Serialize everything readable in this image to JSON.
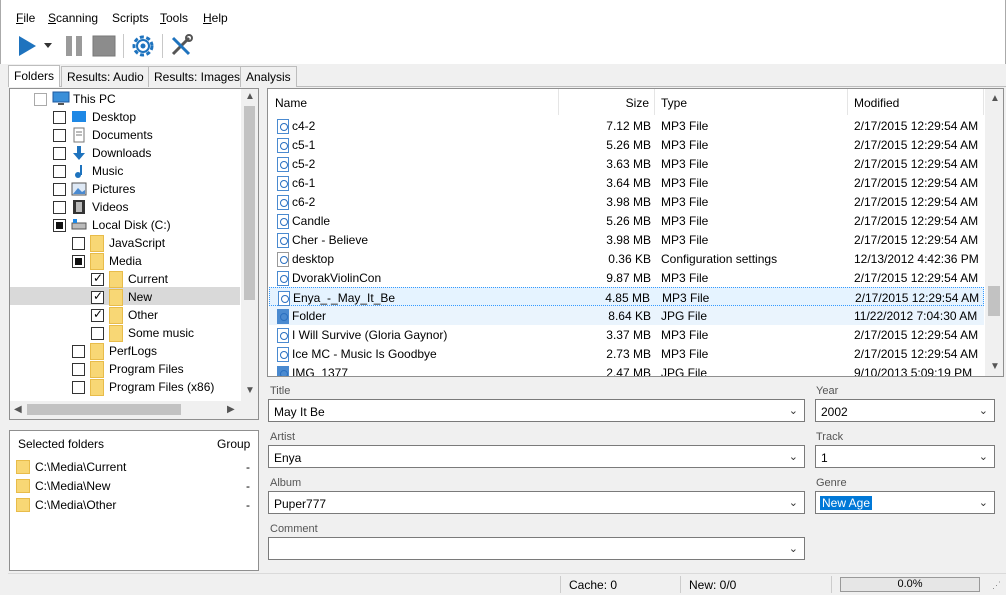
{
  "menu": [
    {
      "label": "File",
      "ul": "F",
      "rest": "ile"
    },
    {
      "label": "Scanning",
      "ul": "S",
      "rest": "canning"
    },
    {
      "label": "Scripts",
      "ul": "",
      "rest": "Scripts"
    },
    {
      "label": "Tools",
      "ul": "T",
      "rest": "ools"
    },
    {
      "label": "Help",
      "ul": "H",
      "rest": "elp"
    }
  ],
  "toolbar": {
    "icons": [
      "play-icon",
      "dropdown-arrow-icon",
      "pause-icon",
      "stop-icon",
      "settings-gear-icon",
      "tools-wrench-icon"
    ]
  },
  "tabs": [
    "Folders",
    "Results: Audio",
    "Results: Images",
    "Analysis"
  ],
  "tree": [
    {
      "label": "This PC",
      "state": "unchecked",
      "icon": "pc-icon"
    },
    {
      "label": "Desktop",
      "state": "unchecked",
      "icon": "desktop-icon"
    },
    {
      "label": "Documents",
      "state": "unchecked",
      "icon": "documents-icon"
    },
    {
      "label": "Downloads",
      "state": "unchecked",
      "icon": "downloads-icon"
    },
    {
      "label": "Music",
      "state": "unchecked",
      "icon": "music-icon"
    },
    {
      "label": "Pictures",
      "state": "unchecked",
      "icon": "pictures-icon"
    },
    {
      "label": "Videos",
      "state": "unchecked",
      "icon": "videos-icon"
    },
    {
      "label": "Local Disk (C:)",
      "state": "partial",
      "icon": "disk-icon"
    },
    {
      "label": "JavaScript",
      "state": "unchecked",
      "icon": "folder-icon"
    },
    {
      "label": "Media",
      "state": "partial",
      "icon": "folder-icon"
    },
    {
      "label": "Current",
      "state": "checked",
      "icon": "folder-icon"
    },
    {
      "label": "New",
      "state": "checked",
      "icon": "folder-icon"
    },
    {
      "label": "Other",
      "state": "checked",
      "icon": "folder-icon"
    },
    {
      "label": "Some music",
      "state": "unchecked",
      "icon": "folder-icon"
    },
    {
      "label": "PerfLogs",
      "state": "unchecked",
      "icon": "folder-icon"
    },
    {
      "label": "Program Files",
      "state": "unchecked",
      "icon": "folder-icon"
    },
    {
      "label": "Program Files (x86)",
      "state": "unchecked",
      "icon": "folder-icon"
    }
  ],
  "selected_folders": {
    "col_name": "Selected folders",
    "col_group": "Group",
    "rows": [
      {
        "path": "C:\\Media\\Current",
        "group": "-"
      },
      {
        "path": "C:\\Media\\New",
        "group": "-"
      },
      {
        "path": "C:\\Media\\Other",
        "group": "-"
      }
    ]
  },
  "filelist": {
    "headers": {
      "name": "Name",
      "size": "Size",
      "type": "Type",
      "modified": "Modified"
    },
    "rows": [
      {
        "name": "c4-2",
        "size": "7.12 MB",
        "type": "MP3 File",
        "modified": "2/17/2015 12:29:54 AM",
        "icon": "mp3-file-icon"
      },
      {
        "name": "c5-1",
        "size": "5.26 MB",
        "type": "MP3 File",
        "modified": "2/17/2015 12:29:54 AM",
        "icon": "mp3-file-icon"
      },
      {
        "name": "c5-2",
        "size": "3.63 MB",
        "type": "MP3 File",
        "modified": "2/17/2015 12:29:54 AM",
        "icon": "mp3-file-icon"
      },
      {
        "name": "c6-1",
        "size": "3.64 MB",
        "type": "MP3 File",
        "modified": "2/17/2015 12:29:54 AM",
        "icon": "mp3-file-icon"
      },
      {
        "name": "c6-2",
        "size": "3.98 MB",
        "type": "MP3 File",
        "modified": "2/17/2015 12:29:54 AM",
        "icon": "mp3-file-icon"
      },
      {
        "name": "Candle",
        "size": "5.26 MB",
        "type": "MP3 File",
        "modified": "2/17/2015 12:29:54 AM",
        "icon": "mp3-file-icon"
      },
      {
        "name": "Cher - Believe",
        "size": "3.98 MB",
        "type": "MP3 File",
        "modified": "2/17/2015 12:29:54 AM",
        "icon": "mp3-file-icon"
      },
      {
        "name": "desktop",
        "size": "0.36 KB",
        "type": "Configuration settings",
        "modified": "12/13/2012 4:42:36 PM",
        "icon": "config-file-icon"
      },
      {
        "name": "DvorakViolinCon",
        "size": "9.87 MB",
        "type": "MP3 File",
        "modified": "2/17/2015 12:29:54 AM",
        "icon": "mp3-file-icon"
      },
      {
        "name": "Enya_-_May_It_Be",
        "size": "4.85 MB",
        "type": "MP3 File",
        "modified": "2/17/2015 12:29:54 AM",
        "icon": "mp3-file-icon"
      },
      {
        "name": "Folder",
        "size": "8.64 KB",
        "type": "JPG File",
        "modified": "11/22/2012 7:04:30 AM",
        "icon": "jpg-file-icon"
      },
      {
        "name": "I Will Survive (Gloria Gaynor)",
        "size": "3.37 MB",
        "type": "MP3 File",
        "modified": "2/17/2015 12:29:54 AM",
        "icon": "mp3-file-icon"
      },
      {
        "name": "Ice MC - Music Is Goodbye",
        "size": "2.73 MB",
        "type": "MP3 File",
        "modified": "2/17/2015 12:29:54 AM",
        "icon": "mp3-file-icon"
      },
      {
        "name": "IMG_1377",
        "size": "2.47 MB",
        "type": "JPG File",
        "modified": "9/10/2013 5:09:19 PM",
        "icon": "jpg-file-icon"
      }
    ]
  },
  "form": {
    "title_label": "Title",
    "title_value": "May It Be",
    "year_label": "Year",
    "year_value": "2002",
    "artist_label": "Artist",
    "artist_value": "Enya",
    "track_label": "Track",
    "track_value": "1",
    "album_label": "Album",
    "album_value": "Puper777",
    "genre_label": "Genre",
    "genre_value": "New Age",
    "comment_label": "Comment",
    "comment_value": ""
  },
  "status": {
    "cache": "Cache: 0",
    "new": "New: 0/0",
    "progress": "0.0%",
    "progress_value": 0
  },
  "colors": {
    "accent": "#0078d7",
    "selection": "#cde8ff",
    "play": "#1e73be"
  }
}
